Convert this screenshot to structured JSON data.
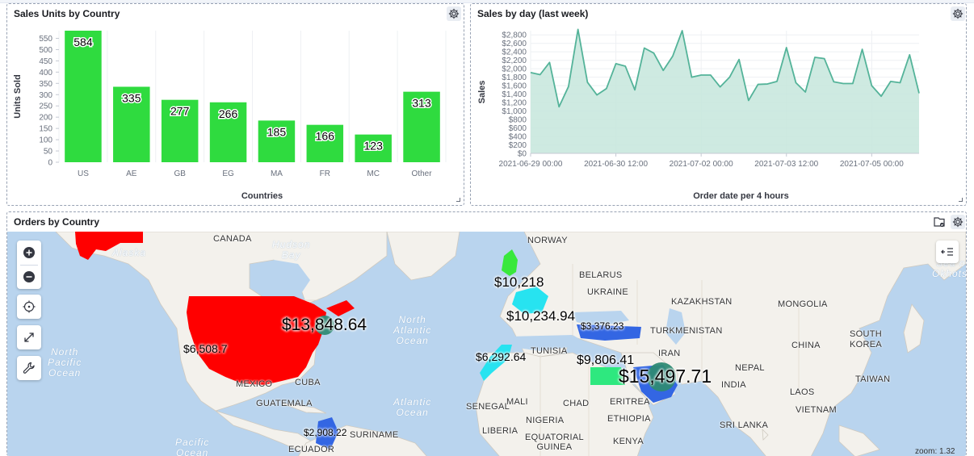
{
  "panels": {
    "units": {
      "title": "Sales Units by Country",
      "chart_data": {
        "type": "bar",
        "title": "Sales Units by Country",
        "categories": [
          "US",
          "AE",
          "GB",
          "EG",
          "MA",
          "FR",
          "MC",
          "Other"
        ],
        "values": [
          584,
          335,
          277,
          266,
          185,
          166,
          123,
          313
        ],
        "value_labels": [
          "584",
          "335",
          "277",
          "266",
          "185",
          "166",
          "123",
          "313"
        ],
        "xlabel": "Countries",
        "ylabel": "Units Sold",
        "ylim": [
          0,
          584
        ],
        "yticks": [
          0,
          50,
          100,
          150,
          200,
          250,
          300,
          350,
          400,
          450,
          500,
          550
        ],
        "ytick_labels": [
          "0",
          "50",
          "100",
          "150",
          "200",
          "250",
          "300",
          "350",
          "400",
          "450",
          "500",
          "550"
        ],
        "grid": true,
        "color": "#2fdb3f"
      }
    },
    "sales": {
      "title": "Sales by day (last week)",
      "chart_data": {
        "type": "area",
        "title": "Sales by day (last week)",
        "x": [
          "2021-06-29 00:00",
          "2021-06-29 04:00",
          "2021-06-29 08:00",
          "2021-06-29 12:00",
          "2021-06-29 16:00",
          "2021-06-29 20:00",
          "2021-06-30 00:00",
          "2021-06-30 04:00",
          "2021-06-30 08:00",
          "2021-06-30 12:00",
          "2021-06-30 16:00",
          "2021-06-30 20:00",
          "2021-07-01 00:00",
          "2021-07-01 04:00",
          "2021-07-01 08:00",
          "2021-07-01 12:00",
          "2021-07-01 16:00",
          "2021-07-01 20:00",
          "2021-07-02 00:00",
          "2021-07-02 04:00",
          "2021-07-02 08:00",
          "2021-07-02 12:00",
          "2021-07-02 16:00",
          "2021-07-02 20:00",
          "2021-07-03 00:00",
          "2021-07-03 04:00",
          "2021-07-03 08:00",
          "2021-07-03 12:00",
          "2021-07-03 16:00",
          "2021-07-03 20:00",
          "2021-07-04 00:00",
          "2021-07-04 04:00",
          "2021-07-04 08:00",
          "2021-07-04 12:00",
          "2021-07-04 16:00",
          "2021-07-04 20:00",
          "2021-07-05 00:00",
          "2021-07-05 04:00",
          "2021-07-05 08:00",
          "2021-07-05 12:00",
          "2021-07-05 16:00"
        ],
        "values": [
          1910,
          1860,
          2150,
          1100,
          1580,
          2930,
          1680,
          1380,
          1530,
          2120,
          2060,
          1500,
          2490,
          2370,
          1960,
          2300,
          2900,
          1800,
          1850,
          1850,
          1570,
          1800,
          2220,
          1250,
          1630,
          1640,
          1700,
          2500,
          1670,
          1450,
          2270,
          2240,
          1690,
          1650,
          1650,
          2460,
          1600,
          1350,
          1700,
          1670,
          2330,
          1420
        ],
        "xtick_labels": [
          "2021-06-29 00:00",
          "2021-06-30 12:00",
          "2021-07-02 00:00",
          "2021-07-03 12:00",
          "2021-07-05 00:00"
        ],
        "yticks": [
          0,
          200,
          400,
          600,
          800,
          1000,
          1200,
          1400,
          1600,
          1800,
          2000,
          2200,
          2400,
          2600,
          2800
        ],
        "ytick_labels": [
          "$0",
          "$200",
          "$400",
          "$600",
          "$800",
          "$1,000",
          "$1,200",
          "$1,400",
          "$1,600",
          "$1,800",
          "$2,000",
          "$2,200",
          "$2,400",
          "$2,600",
          "$2,800"
        ],
        "ylim": [
          0,
          2900
        ],
        "xlabel": "Order date per 4 hours",
        "ylabel": "Sales",
        "grid": true,
        "line_color": "#54b399",
        "fill_color": "#c6e6dc"
      }
    },
    "map": {
      "title": "Orders by Country",
      "country_labels": {
        "canada": "CANADA",
        "norway": "NORWAY",
        "belarus": "BELARUS",
        "ukraine": "UKRAINE",
        "kazakhstan": "KAZAKHSTAN",
        "mongolia": "MONGOLIA",
        "turkmenistan": "TURKMENISTAN",
        "south_korea": "SOUTH\nKOREA",
        "china": "CHINA",
        "iran": "IRAN",
        "nepal": "NEPAL",
        "taiwan": "TAIWAN",
        "india": "INDIA",
        "laos": "LAOS",
        "vietnam": "VIETNAM",
        "sri_lanka": "SRI LANKA",
        "tunisia": "TUNISIA",
        "mali": "MALI",
        "chad": "CHAD",
        "eritrea": "ERITREA",
        "senegal": "SENEGAL",
        "nigeria": "NIGERIA",
        "ethiopia": "ETHIOPIA",
        "liberia": "LIBERIA",
        "equatorial_guinea": "EQUATORIAL\nGUINEA",
        "kenya": "KENYA",
        "mexico": "MEXICO",
        "cuba": "CUBA",
        "guatemala": "GUATEMALA",
        "suriname": "SURINAME",
        "ecuador": "ECUADOR"
      },
      "ocean_labels": {
        "hudson_bay": "Hudson\nBay",
        "alaska": "Alaska",
        "north_atlantic": "North\nAtlantic\nOcean",
        "north_pacific": "North\nPacific\nOcean",
        "atlantic": "Atlantic\nOcean",
        "pacific": "Pacific\nOcean",
        "sea_okhotsk": "Sea of\nOkhotsk"
      },
      "value_labels": {
        "gb": "$10,218",
        "fr": "$10,234.94",
        "us_bubble": "$13,848.64",
        "us_region": "$6,508.7",
        "tr": "$3,376.23",
        "ma": "$6,292.64",
        "eg": "$9,806.41",
        "ae": "$15,497.71",
        "co": "$2,908.22"
      },
      "zoom_label": "zoom: 1.32",
      "colors": {
        "water": "#b9d4ee",
        "land": "#f3f1ec",
        "us": "#ff0000",
        "gb": "#39e83c",
        "fr": "#27e3f0",
        "ma": "#27e3f0",
        "eg": "#2ee87f",
        "blue": "#3366e3",
        "bubble": "#2e8a74"
      },
      "icons": [
        "plus-icon",
        "minus-icon",
        "crosshair-icon",
        "expand-icon",
        "wrench-icon",
        "layers-icon",
        "gear-icon",
        "filter-file-icon"
      ]
    }
  }
}
